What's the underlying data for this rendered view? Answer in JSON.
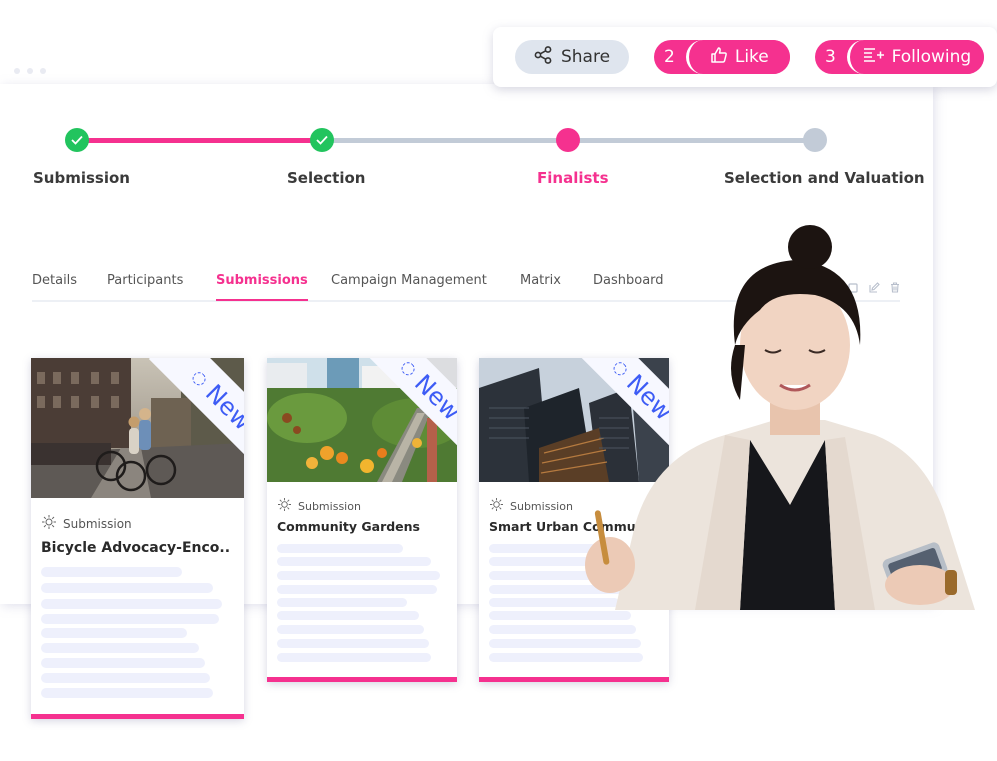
{
  "action_bar": {
    "share_label": "Share",
    "like": {
      "count": "2",
      "label": "Like"
    },
    "following": {
      "count": "3",
      "label": "Following"
    }
  },
  "stepper": {
    "steps": [
      {
        "label": "Submission",
        "status": "done"
      },
      {
        "label": "Selection",
        "status": "done"
      },
      {
        "label": "Finalists",
        "status": "active"
      },
      {
        "label": "Selection and Valuation",
        "status": "todo"
      }
    ]
  },
  "tabs": [
    {
      "label": "Details",
      "active": false
    },
    {
      "label": "Participants",
      "active": false
    },
    {
      "label": "Submissions",
      "active": true
    },
    {
      "label": "Campaign Management",
      "active": false
    },
    {
      "label": "Matrix",
      "active": false
    },
    {
      "label": "Dashboard",
      "active": false
    }
  ],
  "tab_tools": [
    "copy-icon",
    "edit-icon",
    "trash-icon"
  ],
  "cards": [
    {
      "badge": "New",
      "type": "Submission",
      "title": "Bicycle Advocacy-Enco..",
      "image": "cyclists-on-city-street"
    },
    {
      "badge": "New",
      "type": "Submission",
      "title": "Community Gardens",
      "image": "community-garden"
    },
    {
      "badge": "New",
      "type": "Submission",
      "title": "Smart Urban Communi..",
      "image": "skyscrapers"
    }
  ],
  "colors": {
    "accent": "#f5318f",
    "done": "#22c45e",
    "pending": "#c2cbd7",
    "badge_text": "#3d5cf5"
  }
}
